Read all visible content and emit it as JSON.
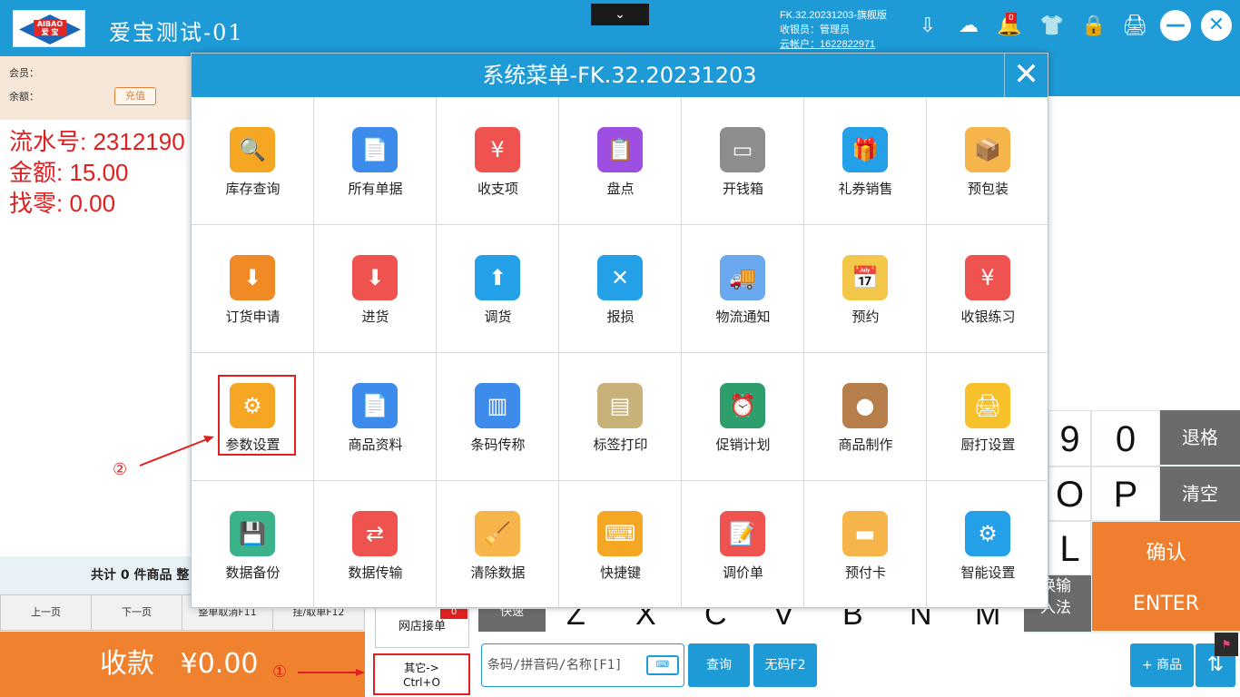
{
  "topbar": {
    "app_title": "爱宝测试-01",
    "logo_top": "AIBAO",
    "logo_bottom": "爱 宝",
    "version": "FK.32.20231203-旗舰版",
    "cashier": "收银员：管理员",
    "cloud_account": "云帐户：1622822971",
    "notification_count": "0",
    "collapse_glyph": "⌄"
  },
  "left": {
    "member_label": "会员：",
    "balance_label": "余额：",
    "recharge": "充值",
    "serial": "流水号: 2312190",
    "amount": "金额: 15.00",
    "change": "找零: 0.00",
    "totals": "共计 0 件商品 整",
    "prev_page": "上一页",
    "next_page": "下一页",
    "cancel_order": "整单取消F11",
    "hold_order": "挂/取单F12",
    "pay_label": "收款",
    "pay_amount": "¥0.00"
  },
  "side": {
    "online_orders": "网店接单",
    "online_badge": "0",
    "other_line1": "其它->",
    "other_line2": "Ctrl+O"
  },
  "modal": {
    "title": "系统菜单-FK.32.20231203",
    "close": "✕",
    "items": [
      {
        "label": "库存查询",
        "color": "#f5a623",
        "glyph": "🔍"
      },
      {
        "label": "所有单据",
        "color": "#3d8bea",
        "glyph": "📄"
      },
      {
        "label": "收支项",
        "color": "#ef5350",
        "glyph": "¥"
      },
      {
        "label": "盘点",
        "color": "#9c4fe0",
        "glyph": "📋"
      },
      {
        "label": "开钱箱",
        "color": "#8d8d8d",
        "glyph": "▭"
      },
      {
        "label": "礼券销售",
        "color": "#23a0e8",
        "glyph": "🎁"
      },
      {
        "label": "预包装",
        "color": "#f6b54a",
        "glyph": "📦"
      },
      {
        "label": "订货申请",
        "color": "#f08a24",
        "glyph": "⬇"
      },
      {
        "label": "进货",
        "color": "#ef5350",
        "glyph": "⬇"
      },
      {
        "label": "调货",
        "color": "#23a0e8",
        "glyph": "⬆"
      },
      {
        "label": "报损",
        "color": "#23a0e8",
        "glyph": "✕"
      },
      {
        "label": "物流通知",
        "color": "#6aa9f0",
        "glyph": "🚚"
      },
      {
        "label": "预约",
        "color": "#f3c74a",
        "glyph": "📅"
      },
      {
        "label": "收银练习",
        "color": "#ef5350",
        "glyph": "¥"
      },
      {
        "label": "参数设置",
        "color": "#f5a623",
        "glyph": "⚙"
      },
      {
        "label": "商品资料",
        "color": "#3d8bea",
        "glyph": "📄"
      },
      {
        "label": "条码传称",
        "color": "#3d8bea",
        "glyph": "▥"
      },
      {
        "label": "标签打印",
        "color": "#c9b27a",
        "glyph": "▤"
      },
      {
        "label": "促销计划",
        "color": "#2e9e6c",
        "glyph": "⏰"
      },
      {
        "label": "商品制作",
        "color": "#b57e4a",
        "glyph": "●"
      },
      {
        "label": "厨打设置",
        "color": "#f6c12a",
        "glyph": "🖨"
      },
      {
        "label": "数据备份",
        "color": "#3bb38a",
        "glyph": "💾"
      },
      {
        "label": "数据传输",
        "color": "#ef5350",
        "glyph": "⇄"
      },
      {
        "label": "清除数据",
        "color": "#f6b54a",
        "glyph": "🧹"
      },
      {
        "label": "快捷键",
        "color": "#f5a623",
        "glyph": "⌨"
      },
      {
        "label": "调价单",
        "color": "#ef5350",
        "glyph": "📝"
      },
      {
        "label": "预付卡",
        "color": "#f6b54a",
        "glyph": "▬"
      },
      {
        "label": "智能设置",
        "color": "#23a0e8",
        "glyph": "⚙"
      }
    ]
  },
  "keyboard": {
    "k9": "9",
    "k0": "0",
    "backspace": "退格",
    "kO": "O",
    "kP": "P",
    "clear": "清空",
    "kL": "L",
    "confirm": "确认",
    "enter": "ENTER",
    "switch_input_1": "换输",
    "switch_input_2": "入法",
    "letters": [
      "Z",
      "X",
      "C",
      "V",
      "B",
      "N",
      "M"
    ],
    "first_key": "快速"
  },
  "bottom": {
    "search_placeholder": "条码/拼音码/名称[F1]",
    "keyboard_icon": "⌨",
    "query": "查询",
    "no_code": "无码F2",
    "add_product": "+ 商品",
    "sort_icon": "⇅"
  },
  "annotations": {
    "step1": "①",
    "step2": "②"
  },
  "colors": {
    "primary": "#1e9bd7",
    "orange": "#f0822f",
    "red": "#e02020"
  }
}
